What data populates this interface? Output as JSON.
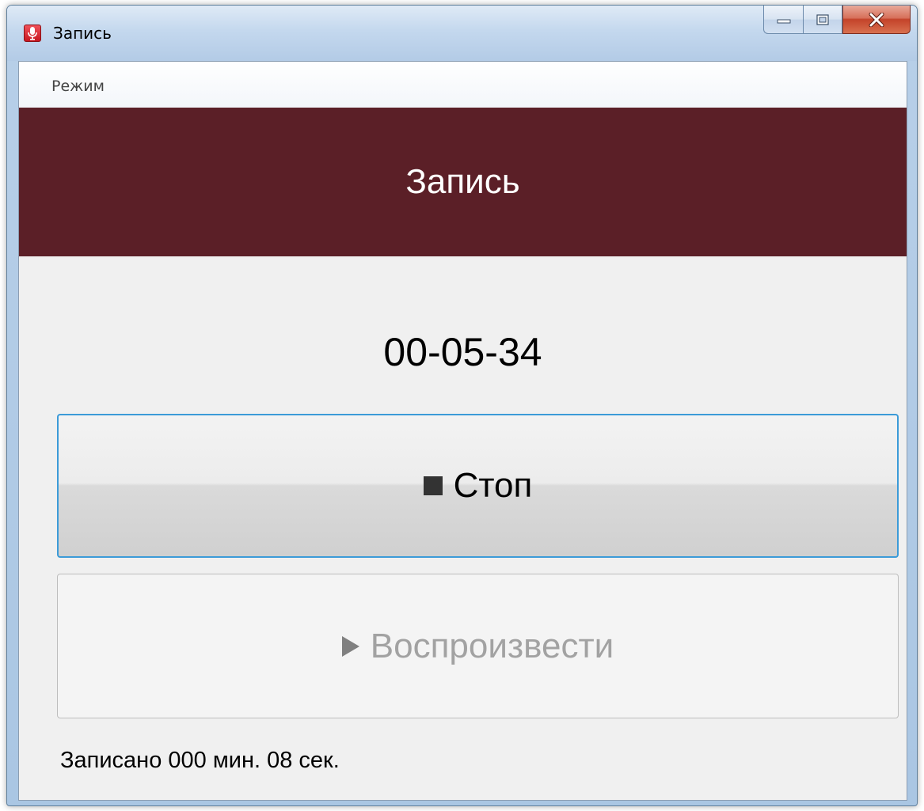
{
  "window": {
    "title": "Запись",
    "icon": "microphone-icon"
  },
  "menu": {
    "items": [
      {
        "label": "Режим"
      }
    ]
  },
  "banner": {
    "title": "Запись",
    "color": "#5b1f27"
  },
  "timer": {
    "value": "00-05-34"
  },
  "buttons": {
    "stop": {
      "label": "Стоп",
      "icon": "stop-icon"
    },
    "play": {
      "label": "Воспроизвести",
      "icon": "play-icon",
      "enabled": false
    }
  },
  "status": {
    "text": "Записано 000 мин. 08 сек."
  }
}
